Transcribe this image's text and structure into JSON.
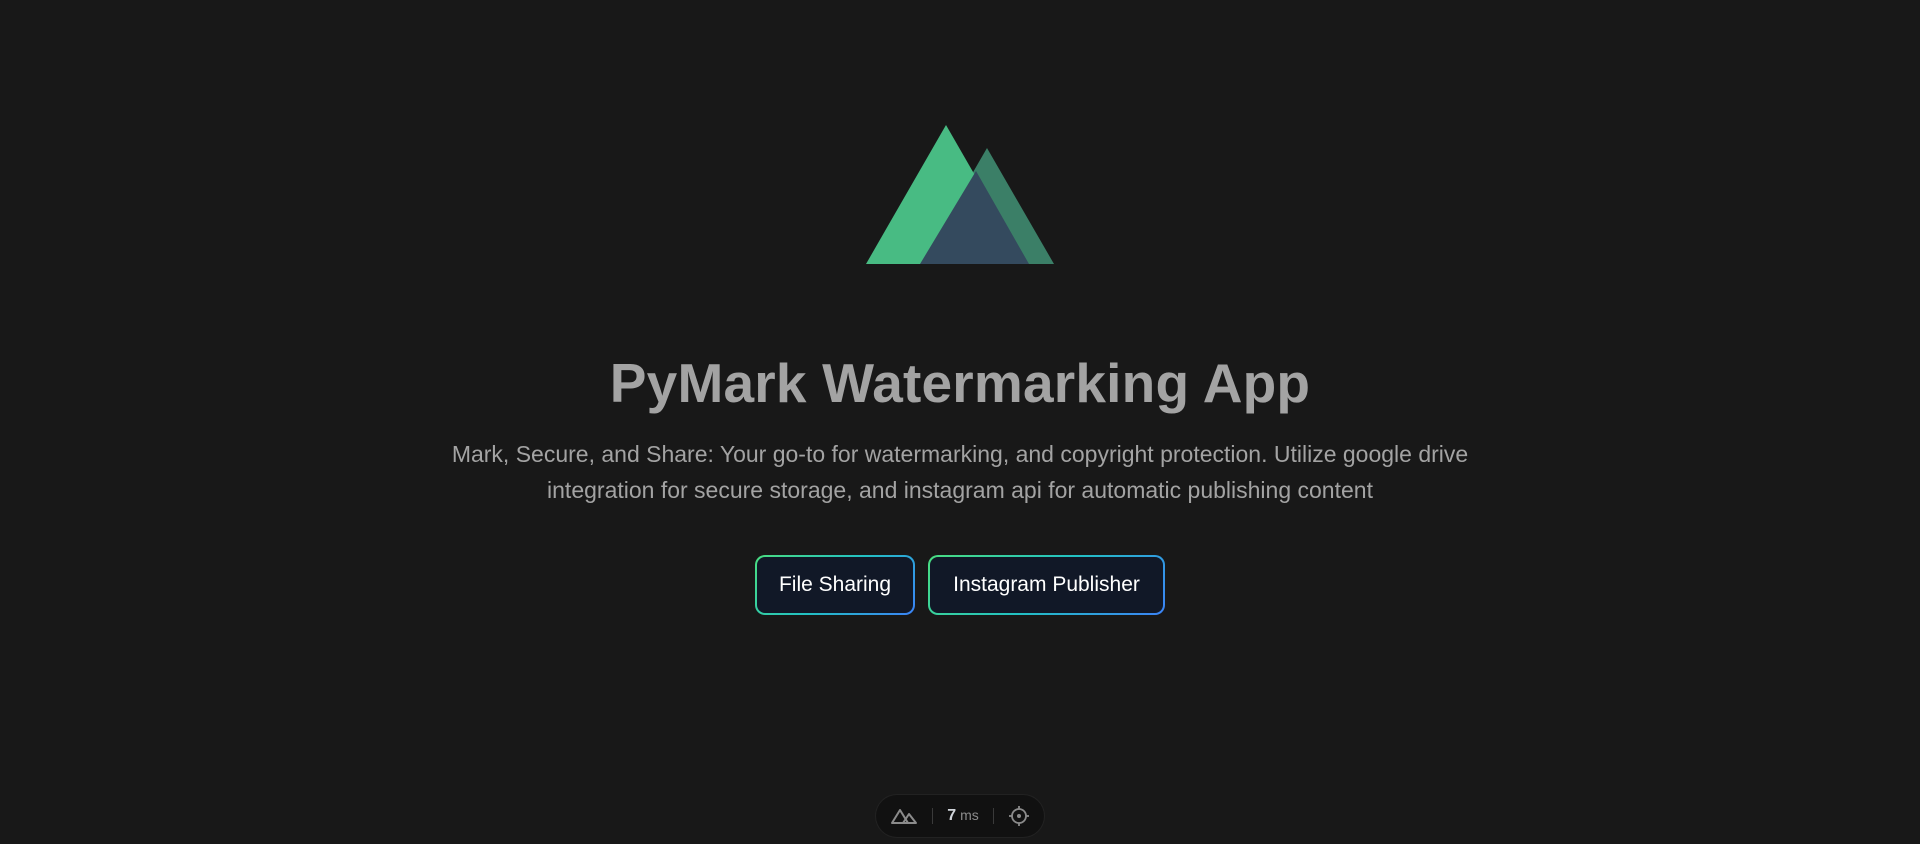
{
  "app": {
    "title": "PyMark Watermarking App",
    "description": "Mark, Secure, and Share: Your go-to for watermarking, and copyright protection. Utilize google drive integration for secure storage, and instagram api for automatic publishing content"
  },
  "logo": {
    "icon": "nuxt-mountain-logo",
    "colors": {
      "front": "#48bb83",
      "back": "#3b7f67",
      "overlap": "#344a5e"
    }
  },
  "actions": {
    "file_sharing_label": "File Sharing",
    "instagram_publisher_label": "Instagram Publisher",
    "gradient": [
      "#4ade80",
      "#22c1c3",
      "#3b82f6"
    ]
  },
  "devtools": {
    "icon": "nuxt-icon",
    "render_time_value": "7",
    "render_time_unit": "ms",
    "inspect_icon": "crosshair-icon"
  }
}
